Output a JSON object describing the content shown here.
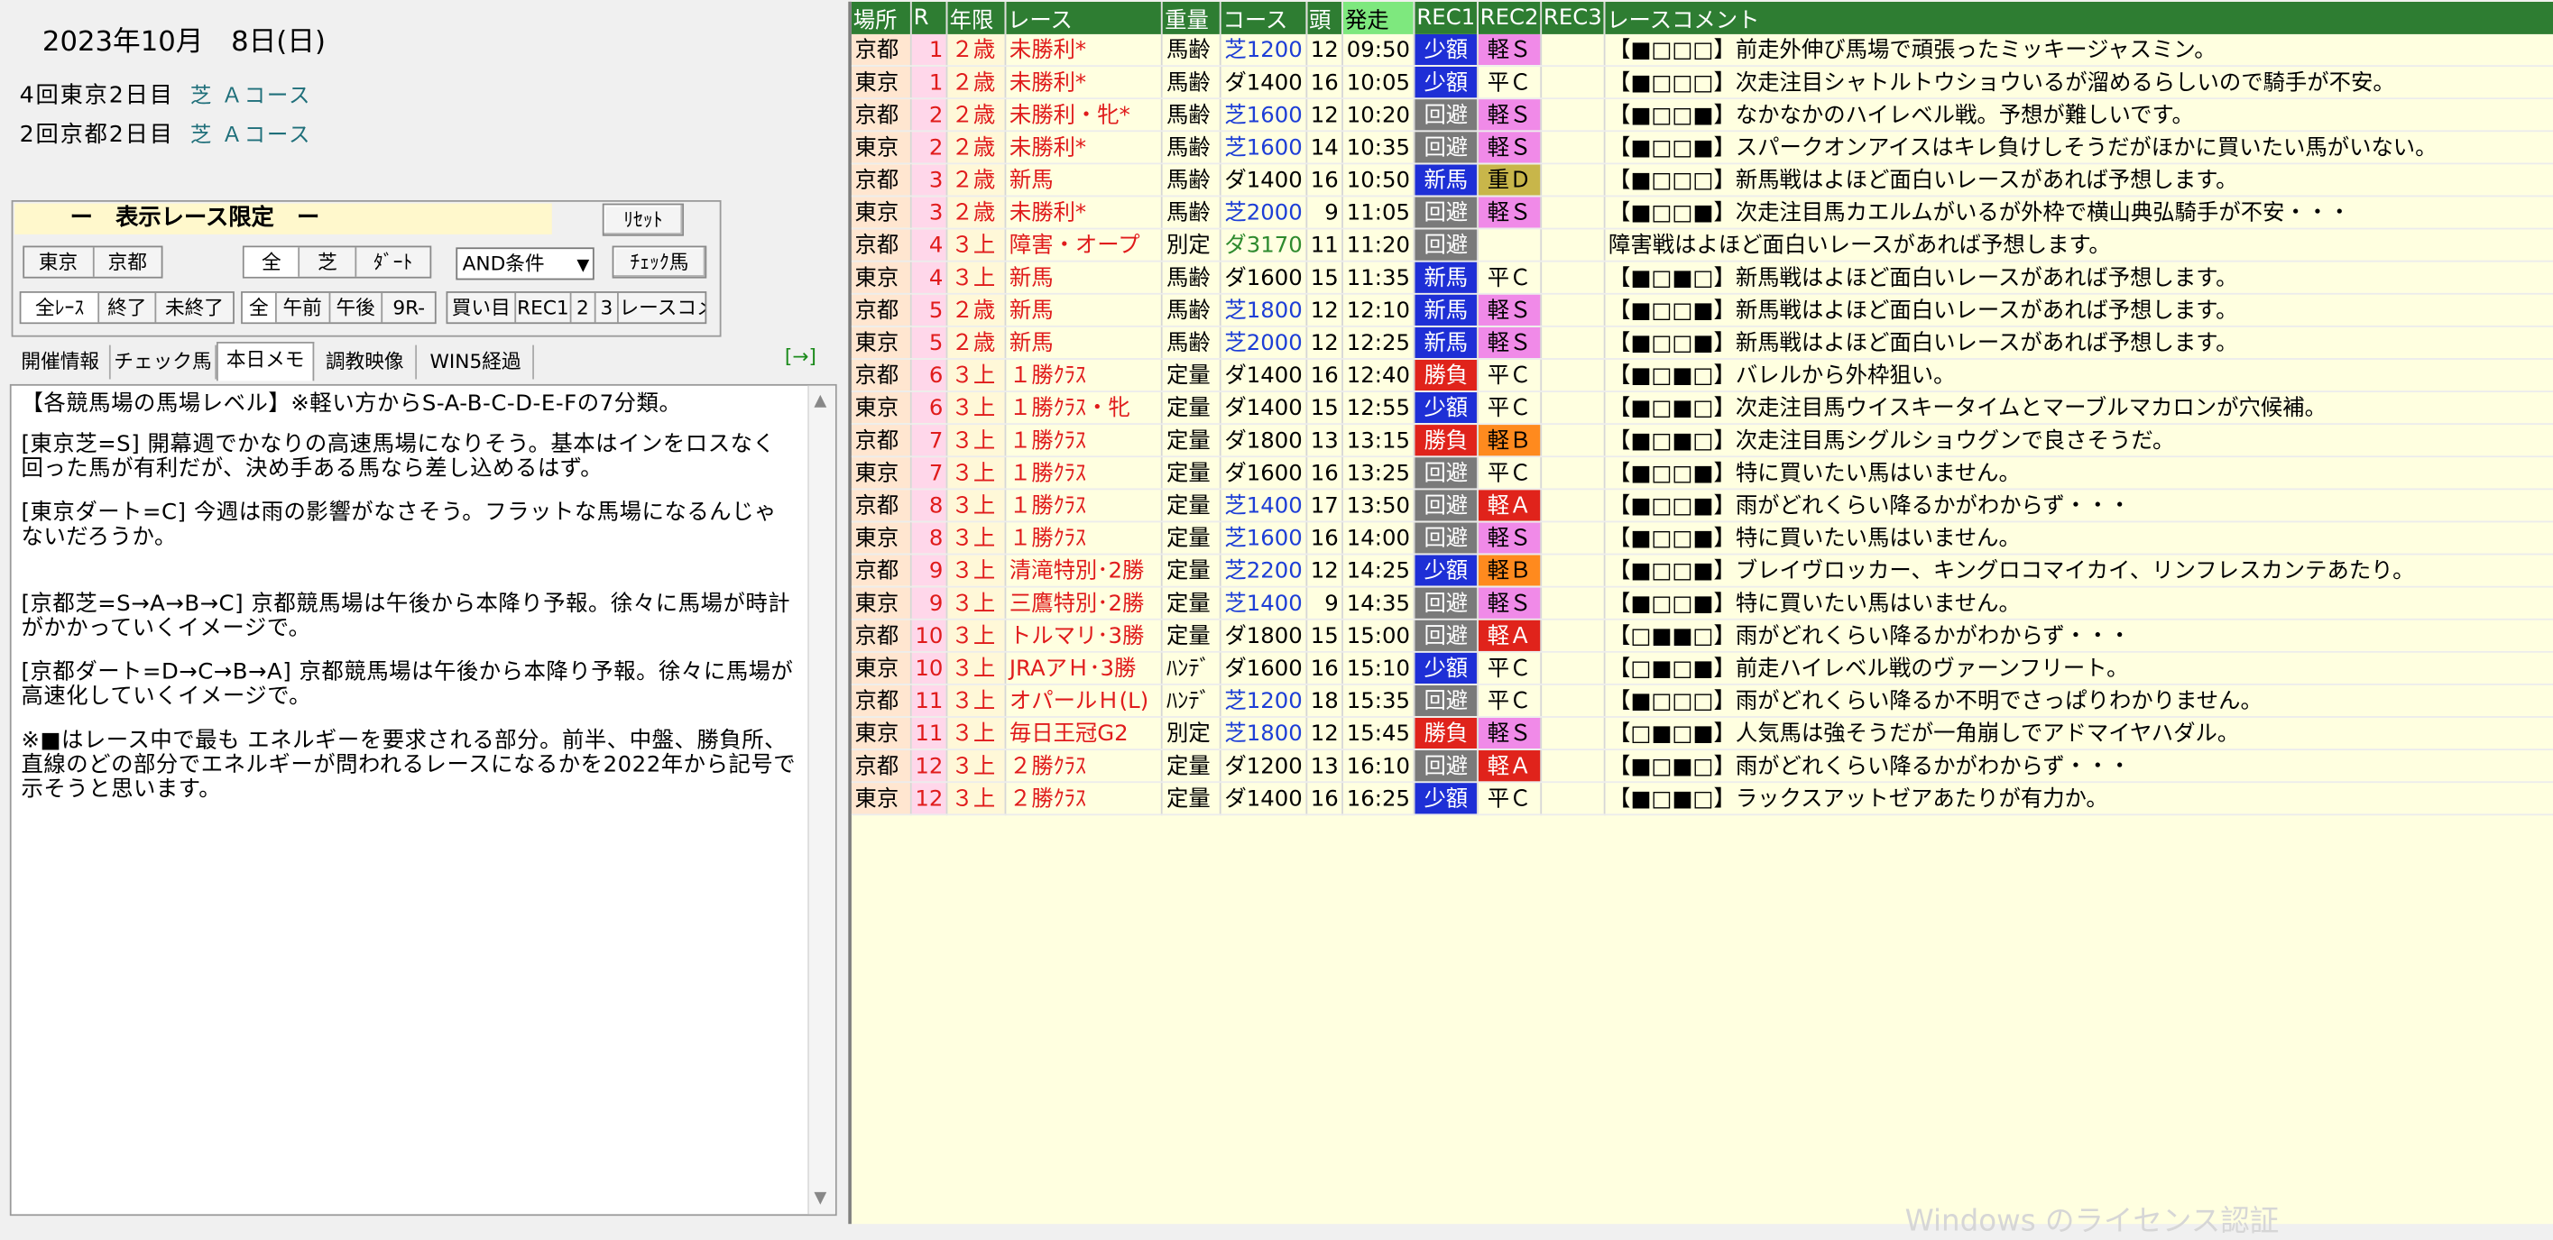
{
  "date": "2023年10月　8日(日)",
  "meetings": [
    {
      "name": "4回東京2日目",
      "course": "芝 Ａコース"
    },
    {
      "name": "2回京都2日目",
      "course": "芝 Ａコース"
    }
  ],
  "filter_panel": {
    "title": "ー　表示レース限定　ー",
    "reset": "ﾘｾｯﾄ",
    "tokyo": "東京",
    "kyoto": "京都",
    "surface_all": "全",
    "turf": "芝",
    "dirt": "ﾀﾞｰﾄ",
    "condition": "AND条件",
    "check_horse": "ﾁｪｯｸ馬",
    "all_races": "全ﾚｰｽ",
    "finished": "終了",
    "unfinished": "未終了",
    "time_all": "全",
    "morning": "午前",
    "afternoon": "午後",
    "after_9r": "9R-",
    "buy": "買い目",
    "rec1": "REC1",
    "rec2": "2",
    "rec3": "3",
    "race_comment": "レースコメ"
  },
  "tabs": [
    "開催情報",
    "チェック馬",
    "本日メモ",
    "調教映像",
    "WIN5経過"
  ],
  "tab_arrow": "[→]",
  "memo": [
    "【各競馬場の馬場レベル】※軽い方からS-A-B-C-D-E-Fの7分類。",
    "[東京芝=S] 開幕週でかなりの高速馬場になりそう。基本はインをロスなく回った馬が有利だが、決め手ある馬なら差し込めるはず。",
    "[東京ダート=C] 今週は雨の影響がなさそう。フラットな馬場になるんじゃないだろうか。",
    "[京都芝=S→A→B→C] 京都競馬場は午後から本降り予報。徐々に馬場が時計がかかっていくイメージで。",
    "[京都ダート=D→C→B→A] 京都競馬場は午後から本降り予報。徐々に馬場が高速化していくイメージで。",
    "※■はレース中で最も エネルギーを要求される部分。前半、中盤、勝負所、直線のどの部分でエネルギーが問われるレースになるかを2022年から記号で示そうと思います。"
  ],
  "table": {
    "headers": [
      "場所",
      "R",
      "年限",
      "レース",
      "重量",
      "コース",
      "頭",
      "発走",
      "REC1",
      "REC2",
      "REC3",
      "レースコメント"
    ],
    "rows": [
      {
        "place": "京都",
        "r": "1",
        "age": "２歳",
        "race": "未勝利*",
        "weight": "馬齢",
        "course": "芝1200",
        "heads": "12",
        "time": "09:50",
        "rec1": "少額",
        "rec1c": "blue",
        "rec2": "軽Ｓ",
        "rec2c": "pink",
        "comment": "【■□□□】前走外伸び馬場で頑張ったミッキージャスミン。"
      },
      {
        "place": "東京",
        "r": "1",
        "age": "２歳",
        "race": "未勝利*",
        "weight": "馬齢",
        "course": "ダ1400",
        "heads": "16",
        "time": "10:05",
        "rec1": "少額",
        "rec1c": "blue",
        "rec2": "平Ｃ",
        "rec2c": "",
        "comment": "【■□□□】次走注目シャトルトウショウいるが溜めるらしいので騎手が不安。"
      },
      {
        "place": "京都",
        "r": "2",
        "age": "２歳",
        "race": "未勝利・牝*",
        "weight": "馬齢",
        "course": "芝1600",
        "heads": "12",
        "time": "10:20",
        "rec1": "回避",
        "rec1c": "gray",
        "rec2": "軽Ｓ",
        "rec2c": "pink",
        "comment": "【■□□■】なかなかのハイレベル戦。予想が難しいです。"
      },
      {
        "place": "東京",
        "r": "2",
        "age": "２歳",
        "race": "未勝利*",
        "weight": "馬齢",
        "course": "芝1600",
        "heads": "14",
        "time": "10:35",
        "rec1": "回避",
        "rec1c": "gray",
        "rec2": "軽Ｓ",
        "rec2c": "pink",
        "comment": "【■□□■】スパークオンアイスはキレ負けしそうだがほかに買いたい馬がいない。"
      },
      {
        "place": "京都",
        "r": "3",
        "age": "２歳",
        "race": "新馬",
        "weight": "馬齢",
        "course": "ダ1400",
        "heads": "16",
        "time": "10:50",
        "rec1": "新馬",
        "rec1c": "blue",
        "rec2": "重Ｄ",
        "rec2c": "olive",
        "comment": "【■□□□】新馬戦はよほど面白いレースがあれば予想します。"
      },
      {
        "place": "東京",
        "r": "3",
        "age": "２歳",
        "race": "未勝利*",
        "weight": "馬齢",
        "course": "芝2000",
        "heads": "9",
        "time": "11:05",
        "rec1": "回避",
        "rec1c": "gray",
        "rec2": "軽Ｓ",
        "rec2c": "pink",
        "comment": "【■□□■】次走注目馬カエルムがいるが外枠で横山典弘騎手が不安・・・"
      },
      {
        "place": "京都",
        "r": "4",
        "age": "３上",
        "race": "障害・オープ",
        "weight": "別定",
        "course": "ダ3170",
        "heads": "11",
        "time": "11:20",
        "rec1": "回避",
        "rec1c": "gray",
        "rec2": "",
        "rec2c": "",
        "comment": "障害戦はよほど面白いレースがあれば予想します。"
      },
      {
        "place": "東京",
        "r": "4",
        "age": "３上",
        "race": "新馬",
        "weight": "馬齢",
        "course": "ダ1600",
        "heads": "15",
        "time": "11:35",
        "rec1": "新馬",
        "rec1c": "blue",
        "rec2": "平Ｃ",
        "rec2c": "",
        "comment": "【■□■□】新馬戦はよほど面白いレースがあれば予想します。"
      },
      {
        "place": "京都",
        "r": "5",
        "age": "２歳",
        "race": "新馬",
        "weight": "馬齢",
        "course": "芝1800",
        "heads": "12",
        "time": "12:10",
        "rec1": "新馬",
        "rec1c": "blue",
        "rec2": "軽Ｓ",
        "rec2c": "pink",
        "comment": "【■□□■】新馬戦はよほど面白いレースがあれば予想します。"
      },
      {
        "place": "東京",
        "r": "5",
        "age": "２歳",
        "race": "新馬",
        "weight": "馬齢",
        "course": "芝2000",
        "heads": "12",
        "time": "12:25",
        "rec1": "新馬",
        "rec1c": "blue",
        "rec2": "軽Ｓ",
        "rec2c": "pink",
        "comment": "【■□□■】新馬戦はよほど面白いレースがあれば予想します。"
      },
      {
        "place": "京都",
        "r": "6",
        "age": "３上",
        "race": "１勝ｸﾗｽ",
        "weight": "定量",
        "course": "ダ1400",
        "heads": "16",
        "time": "12:40",
        "rec1": "勝負",
        "rec1c": "red",
        "rec2": "平Ｃ",
        "rec2c": "",
        "comment": "【■□■□】バレルから外枠狙い。"
      },
      {
        "place": "東京",
        "r": "6",
        "age": "３上",
        "race": "１勝ｸﾗｽ・牝",
        "weight": "定量",
        "course": "ダ1400",
        "heads": "15",
        "time": "12:55",
        "rec1": "少額",
        "rec1c": "blue",
        "rec2": "平Ｃ",
        "rec2c": "",
        "comment": "【■□■□】次走注目馬ウイスキータイムとマーブルマカロンが穴候補。"
      },
      {
        "place": "京都",
        "r": "7",
        "age": "３上",
        "race": "１勝ｸﾗｽ",
        "weight": "定量",
        "course": "ダ1800",
        "heads": "13",
        "time": "13:15",
        "rec1": "勝負",
        "rec1c": "red",
        "rec2": "軽Ｂ",
        "rec2c": "orange",
        "comment": "【■□■□】次走注目馬シグルショウグンで良さそうだ。"
      },
      {
        "place": "東京",
        "r": "7",
        "age": "３上",
        "race": "１勝ｸﾗｽ",
        "weight": "定量",
        "course": "ダ1600",
        "heads": "16",
        "time": "13:25",
        "rec1": "回避",
        "rec1c": "gray",
        "rec2": "平Ｃ",
        "rec2c": "",
        "comment": "【■□□■】特に買いたい馬はいません。"
      },
      {
        "place": "京都",
        "r": "8",
        "age": "３上",
        "race": "１勝ｸﾗｽ",
        "weight": "定量",
        "course": "芝1400",
        "heads": "17",
        "time": "13:50",
        "rec1": "回避",
        "rec1c": "gray",
        "rec2": "軽Ａ",
        "rec2c": "redb",
        "comment": "【■□□■】雨がどれくらい降るかがわからず・・・"
      },
      {
        "place": "東京",
        "r": "8",
        "age": "３上",
        "race": "１勝ｸﾗｽ",
        "weight": "定量",
        "course": "芝1600",
        "heads": "16",
        "time": "14:00",
        "rec1": "回避",
        "rec1c": "gray",
        "rec2": "軽Ｓ",
        "rec2c": "pink",
        "comment": "【■□□■】特に買いたい馬はいません。"
      },
      {
        "place": "京都",
        "r": "9",
        "age": "３上",
        "race": "清滝特別･2勝",
        "weight": "定量",
        "course": "芝2200",
        "heads": "12",
        "time": "14:25",
        "rec1": "少額",
        "rec1c": "blue",
        "rec2": "軽Ｂ",
        "rec2c": "orange",
        "comment": "【■□□■】ブレイヴロッカー、キングロコマイカイ、リンフレスカンテあたり。"
      },
      {
        "place": "東京",
        "r": "9",
        "age": "３上",
        "race": "三鷹特別･2勝",
        "weight": "定量",
        "course": "芝1400",
        "heads": "9",
        "time": "14:35",
        "rec1": "回避",
        "rec1c": "gray",
        "rec2": "軽Ｓ",
        "rec2c": "pink",
        "comment": "【■□□■】特に買いたい馬はいません。"
      },
      {
        "place": "京都",
        "r": "10",
        "age": "３上",
        "race": "トルマリ･3勝",
        "weight": "定量",
        "course": "ダ1800",
        "heads": "15",
        "time": "15:00",
        "rec1": "回避",
        "rec1c": "gray",
        "rec2": "軽Ａ",
        "rec2c": "redb",
        "comment": "【□■■□】雨がどれくらい降るかがわからず・・・"
      },
      {
        "place": "東京",
        "r": "10",
        "age": "３上",
        "race": "JRAアＨ･3勝",
        "weight": "ﾊﾝﾃﾞ",
        "course": "ダ1600",
        "heads": "16",
        "time": "15:10",
        "rec1": "少額",
        "rec1c": "blue",
        "rec2": "平Ｃ",
        "rec2c": "",
        "comment": "【□■□■】前走ハイレベル戦のヴァーンフリート。"
      },
      {
        "place": "京都",
        "r": "11",
        "age": "３上",
        "race": "オパールＨ(L)",
        "weight": "ﾊﾝﾃﾞ",
        "course": "芝1200",
        "heads": "18",
        "time": "15:35",
        "rec1": "回避",
        "rec1c": "gray",
        "rec2": "平Ｃ",
        "rec2c": "",
        "comment": "【■□□□】雨がどれくらい降るか不明でさっぱりわかりません。"
      },
      {
        "place": "東京",
        "r": "11",
        "age": "３上",
        "race": "毎日王冠G2",
        "weight": "別定",
        "course": "芝1800",
        "heads": "12",
        "time": "15:45",
        "rec1": "勝負",
        "rec1c": "red",
        "rec2": "軽Ｓ",
        "rec2c": "pink",
        "comment": "【□■□■】人気馬は強そうだが一角崩しでアドマイヤハダル。"
      },
      {
        "place": "京都",
        "r": "12",
        "age": "３上",
        "race": "２勝ｸﾗｽ",
        "weight": "定量",
        "course": "ダ1200",
        "heads": "13",
        "time": "16:10",
        "rec1": "回避",
        "rec1c": "gray",
        "rec2": "軽Ａ",
        "rec2c": "redb",
        "comment": "【■□■□】雨がどれくらい降るかがわからず・・・"
      },
      {
        "place": "東京",
        "r": "12",
        "age": "３上",
        "race": "２勝ｸﾗｽ",
        "weight": "定量",
        "course": "ダ1400",
        "heads": "16",
        "time": "16:25",
        "rec1": "少額",
        "rec1c": "blue",
        "rec2": "平Ｃ",
        "rec2c": "",
        "comment": "【■□■□】ラックスアットゼアあたりが有力か。"
      }
    ]
  },
  "watermark": "Windows のライセンス認証"
}
